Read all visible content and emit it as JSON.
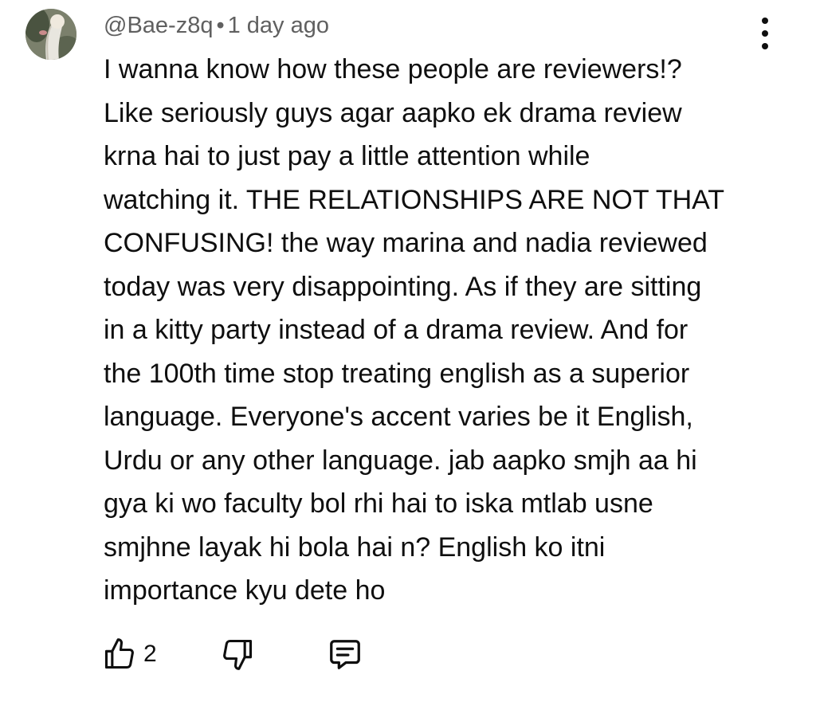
{
  "comment": {
    "handle": "@Bae-z8q",
    "separator": "•",
    "time": "1 day ago",
    "lines": [
      "I wanna know how these people are reviewers!?",
      "Like seriously guys agar aapko ek drama review",
      "krna hai to just pay a little attention while",
      "watching it. THE RELATIONSHIPS ARE NOT THAT",
      "CONFUSING! the way marina and nadia reviewed",
      "today was very disappointing. As if they are sitting",
      "in a kitty party instead of a drama review. And for",
      "the 100th time stop treating english as a superior",
      "language. Everyone's accent varies be it English,",
      "Urdu or any other language. jab aapko smjh aa hi",
      "gya ki wo faculty bol rhi hai to iska mtlab usne",
      "smjhne layak hi bola hai n? English ko itni",
      "importance kyu dete ho"
    ],
    "like_count": "2"
  },
  "icons": {
    "avatar": "avatar-image",
    "more": "more-vert-icon",
    "like": "thumb-up-icon",
    "dislike": "thumb-down-icon",
    "reply": "reply-comment-icon"
  },
  "colors": {
    "text": "#0f0f0f",
    "meta": "#606060",
    "background": "#ffffff"
  }
}
